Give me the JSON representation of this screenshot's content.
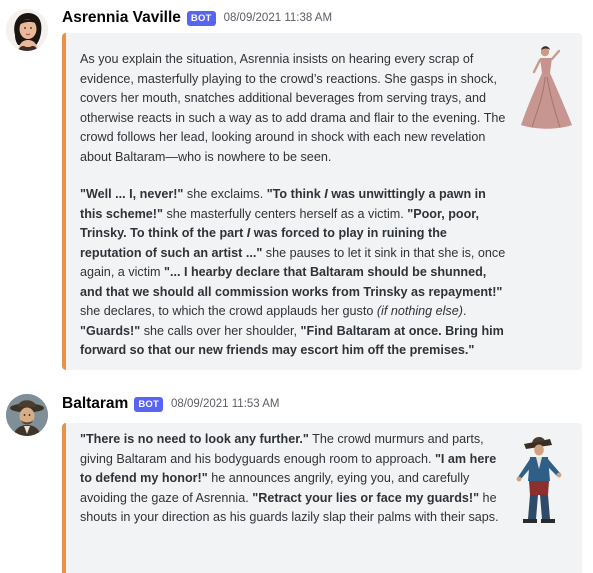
{
  "messages": [
    {
      "username": "Asrennia Vaville",
      "bot_tag": "BOT",
      "timestamp": "08/09/2021 11:38 AM",
      "accent": "#e8914a",
      "p1": "As you explain the situation, Asrennia insists on hearing every scrap of evidence, masterfully playing to the crowd’s reactions. She gasps in shock, covers her mouth, snatches additional beverages from serving trays, and otherwise reacts in such a way as to add drama and flair to the evening. The crowd follows her lead, looking around in shock with each new revelation about Baltaram—who is nowhere to be seen.",
      "p2": {
        "q1": "\"Well ... I, never!\"",
        "t1": " she exclaims. ",
        "q2a": "\"To think ",
        "q2i": "I",
        "q2b": " was unwittingly a pawn in this scheme!\"",
        "t2": " she masterfully centers herself as a victim. ",
        "q3a": "\"Poor, poor, Trinsky. To think of the part ",
        "q3i": "I",
        "q3b": " was forced to play in ruining the reputation of such an artist ...\"",
        "t3": " she pauses to let it sink in that she is, once again, a victim ",
        "q4": "\"... I hearby declare that Baltaram should be shunned, and that we should all commission works from Trinsky as repayment!\"",
        "t4": " she declares, to which the crowd applauds her gusto ",
        "t4i": "(if nothing else)",
        "t4end": ". ",
        "q5": "\"Guards!\"",
        "t5": " she calls over her shoulder, ",
        "q6": "\"Find Baltaram at once. Bring him forward so that our new friends may escort him off the premises.\""
      }
    },
    {
      "username": "Baltaram",
      "bot_tag": "BOT",
      "timestamp": "08/09/2021 11:53 AM",
      "accent": "#e8914a",
      "p1": {
        "q1": "\"There is no need to look any further.\"",
        "t1": " The crowd murmurs and parts, giving Baltaram and his bodyguards enough room to approach. ",
        "q2": "\"I am here to defend my honor!\"",
        "t2": " he announces angrily, eying you, and carefully avoiding the gaze of Asrennia. ",
        "q3": "\"Retract your lies or face my guards!\"",
        "t3": " he shouts in your direction as his guards lazily slap their palms with their saps."
      }
    }
  ]
}
